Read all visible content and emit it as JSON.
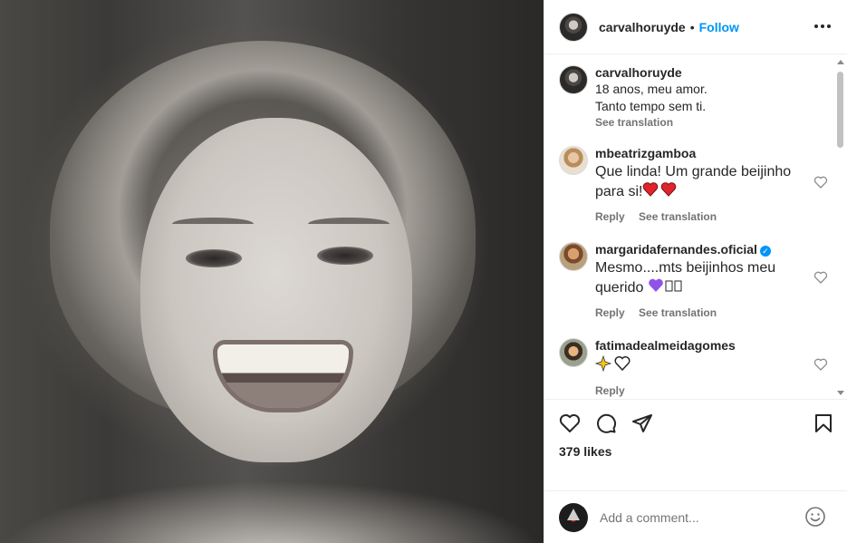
{
  "post": {
    "owner": "carvalhoruyde",
    "follow_label": "Follow",
    "separator": "•",
    "photo_icon": "black-and-white-portrait-smiling-woman"
  },
  "caption": {
    "username": "carvalhoruyde",
    "line1": "18 anos, meu amor.",
    "line2": "Tanto tempo sem ti.",
    "see_translation": "See translation"
  },
  "comments": [
    {
      "username": "mbeatrizgamboa",
      "text": "Que linda! Um grande beijinho para si!",
      "emoji": "❤❤",
      "reply": "Reply",
      "see_translation": "See translation",
      "verified": false
    },
    {
      "username": "margaridafernandes.oficial",
      "text": "Mesmo....mts beijinhos meu querido",
      "emoji": "💜▯▯",
      "reply": "Reply",
      "see_translation": "See translation",
      "verified": true
    },
    {
      "username": "fatimadealmeidagomes",
      "text": "",
      "emoji": "✨♡",
      "reply": "Reply",
      "verified": false
    }
  ],
  "likes": "379 likes",
  "add_comment": {
    "placeholder": "Add a comment..."
  },
  "colors": {
    "accent": "#0095f6",
    "text": "#262626",
    "muted": "#737373",
    "heart_red": "#e0242c",
    "heart_purple": "#8e54e9"
  },
  "icons": [
    "more-options-icon",
    "like-icon",
    "comment-icon",
    "share-icon",
    "save-icon",
    "emoji-icon",
    "comment-like-icon"
  ]
}
